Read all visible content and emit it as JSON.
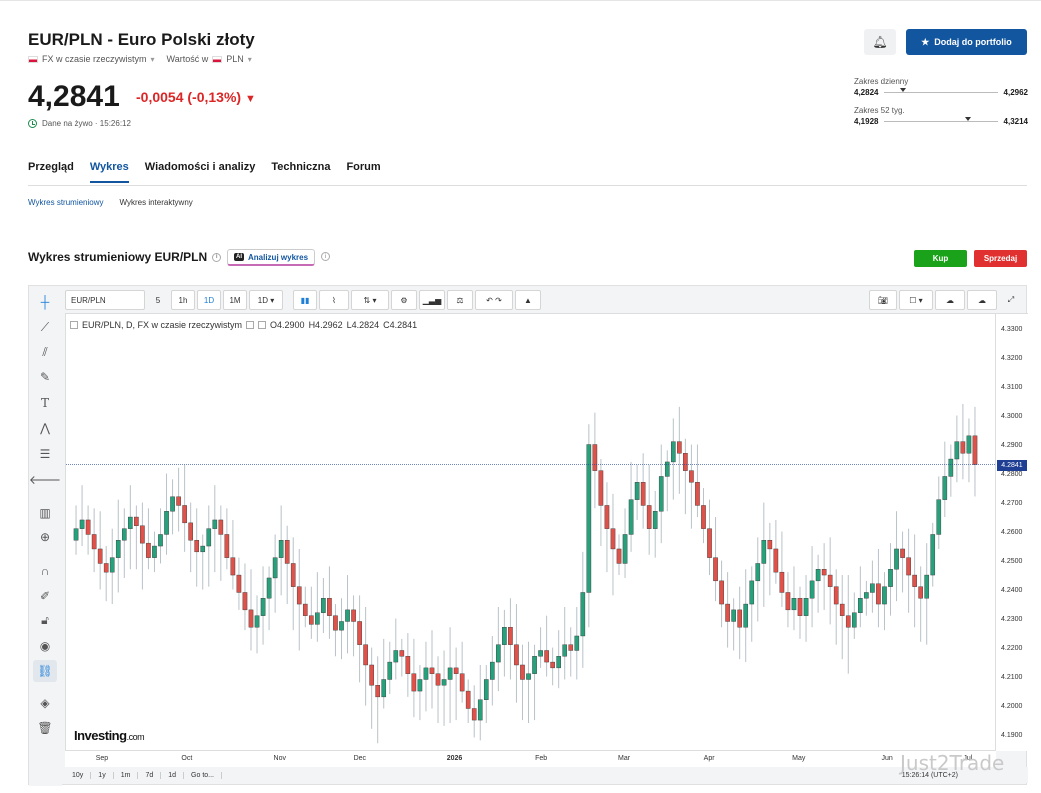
{
  "header": {
    "title": "EUR/PLN - Euro Polski złoty",
    "sub_fx": "FX w czasie rzeczywistym",
    "sub_value_label": "Wartość w",
    "sub_currency": "PLN",
    "price": "4,2841",
    "change": "-0,0054 (-0,13%)",
    "live": "Dane na żywo · 15:26:12",
    "portfolio_button": "Dodaj do portfolio",
    "daily_range_label": "Zakres dzienny",
    "daily_low": "4,2824",
    "daily_high": "4,2962",
    "daily_level": 0.14,
    "week52_label": "Zakres 52 tyg.",
    "week52_low": "4,1928",
    "week52_high": "4,3214",
    "week52_level": 0.71
  },
  "tabs": [
    "Przegląd",
    "Wykres",
    "Wiadomości i analizy",
    "Techniczna",
    "Forum"
  ],
  "subtabs": [
    "Wykres strumieniowy",
    "Wykres interaktywny"
  ],
  "section": {
    "title": "Wykres strumieniowy EUR/PLN",
    "ai_badge": "AI",
    "ai_button": "Analizuj wykres",
    "buy": "Kup",
    "sell": "Sprzedaj"
  },
  "toolbar": {
    "symbol": "EUR/PLN",
    "intervals": [
      "5",
      "1h",
      "1D",
      "1M",
      "1D"
    ]
  },
  "chart_legend": {
    "name": "EUR/PLN, D, FX w czasie rzeczywistym",
    "o": "O4.2900",
    "h": "H4.2962",
    "l": "L4.2824",
    "c": "C4.2841"
  },
  "bottombar": {
    "ranges": [
      "10y",
      "1y",
      "1m",
      "7d",
      "1d",
      "Go to..."
    ],
    "time": "15:26:14 (UTC+2)"
  },
  "logo": {
    "main": "Investing",
    "suffix": ".com"
  },
  "watermark": "Just2Trade",
  "chart_data": {
    "type": "candlestick",
    "y_ticks": [
      "4.3300",
      "4.3200",
      "4.3100",
      "4.3000",
      "4.2900",
      "4.2800",
      "4.2700",
      "4.2600",
      "4.2500",
      "4.2400",
      "4.2300",
      "4.2200",
      "4.2100",
      "4.2000",
      "4.1900"
    ],
    "ylim": [
      4.185,
      4.336
    ],
    "x_labels": [
      "Sep",
      "Oct",
      "Nov",
      "Dec",
      "2026",
      "Feb",
      "Mar",
      "Apr",
      "May",
      "Jun",
      "Jul"
    ],
    "last_price": "4.2841",
    "last_value": 4.2841,
    "closes": [
      4.258,
      4.262,
      4.265,
      4.26,
      4.255,
      4.25,
      4.247,
      4.252,
      4.258,
      4.262,
      4.266,
      4.263,
      4.257,
      4.252,
      4.256,
      4.26,
      4.268,
      4.273,
      4.27,
      4.264,
      4.258,
      4.254,
      4.256,
      4.262,
      4.265,
      4.26,
      4.252,
      4.246,
      4.24,
      4.234,
      4.228,
      4.232,
      4.238,
      4.245,
      4.252,
      4.258,
      4.25,
      4.242,
      4.236,
      4.232,
      4.229,
      4.233,
      4.238,
      4.232,
      4.227,
      4.23,
      4.234,
      4.23,
      4.222,
      4.215,
      4.208,
      4.204,
      4.21,
      4.216,
      4.22,
      4.218,
      4.212,
      4.206,
      4.21,
      4.214,
      4.212,
      4.208,
      4.21,
      4.214,
      4.212,
      4.206,
      4.2,
      4.196,
      4.203,
      4.21,
      4.216,
      4.222,
      4.228,
      4.222,
      4.215,
      4.21,
      4.212,
      4.218,
      4.22,
      4.216,
      4.214,
      4.218,
      4.222,
      4.22,
      4.225,
      4.24,
      4.291,
      4.282,
      4.27,
      4.262,
      4.255,
      4.25,
      4.26,
      4.272,
      4.278,
      4.27,
      4.262,
      4.268,
      4.28,
      4.285,
      4.292,
      4.288,
      4.282,
      4.278,
      4.27,
      4.262,
      4.252,
      4.244,
      4.236,
      4.23,
      4.234,
      4.228,
      4.236,
      4.244,
      4.25,
      4.258,
      4.255,
      4.247,
      4.24,
      4.234,
      4.238,
      4.232,
      4.238,
      4.244,
      4.248,
      4.246,
      4.242,
      4.236,
      4.232,
      4.228,
      4.233,
      4.238,
      4.24,
      4.243,
      4.236,
      4.242,
      4.248,
      4.255,
      4.252,
      4.246,
      4.242,
      4.238,
      4.246,
      4.26,
      4.272,
      4.28,
      4.286,
      4.292,
      4.288,
      4.294,
      4.2841
    ]
  }
}
